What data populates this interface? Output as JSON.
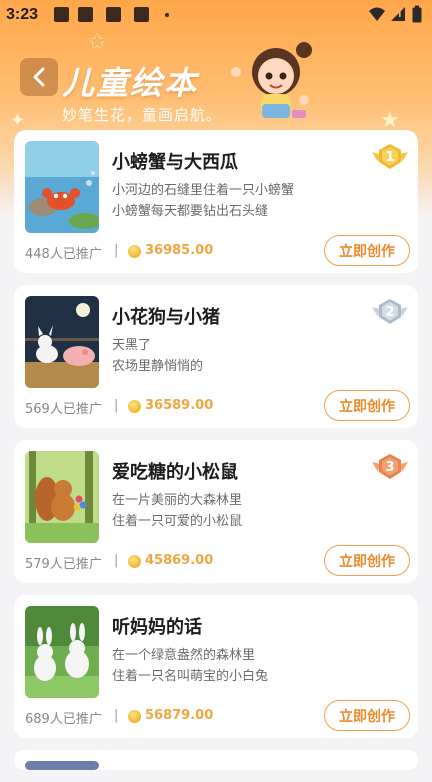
{
  "status_bar": {
    "time": "3:23"
  },
  "header": {
    "title": "儿童绘本",
    "subtitle": "妙笔生花，童画启航。"
  },
  "colors": {
    "accent": "#f0a640",
    "hero_top": "#ffa64a",
    "button_border": "#f0a050"
  },
  "books": [
    {
      "title": "小螃蟹与大西瓜",
      "desc_line1": "小河边的石缝里住着一只小螃蟹",
      "desc_line2": "小螃蟹每天都要钻出石头缝",
      "promoted": "448人已推广",
      "price": "36985.00",
      "rank": "1",
      "button": "立即创作"
    },
    {
      "title": "小花狗与小猪",
      "desc_line1": "天黑了",
      "desc_line2": "农场里静悄悄的",
      "promoted": "569人已推广",
      "price": "36589.00",
      "rank": "2",
      "button": "立即创作"
    },
    {
      "title": "爱吃糖的小松鼠",
      "desc_line1": "在一片美丽的大森林里",
      "desc_line2": "住着一只可爱的小松鼠",
      "promoted": "579人已推广",
      "price": "45869.00",
      "rank": "3",
      "button": "立即创作"
    },
    {
      "title": "听妈妈的话",
      "desc_line1": "在一个绿意盎然的森林里",
      "desc_line2": "住着一只名叫萌宝的小白兔",
      "promoted": "689人已推广",
      "price": "56879.00",
      "button": "立即创作"
    }
  ],
  "separator": "|"
}
